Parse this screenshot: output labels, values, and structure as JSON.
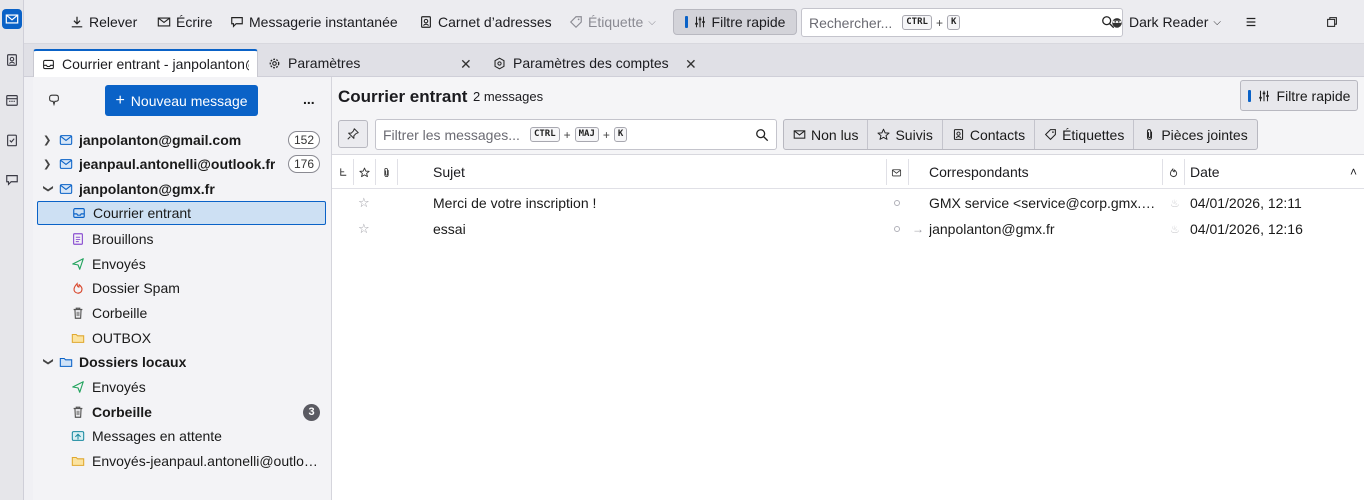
{
  "toolbar": {
    "get_messages": "Relever",
    "write": "Écrire",
    "chat": "Messagerie instantanée",
    "address_book": "Carnet d’adresses",
    "tag": "Étiquette",
    "quick_filter": "Filtre rapide",
    "search_placeholder": "Rechercher...",
    "search_key1": "CTRL",
    "search_plus": "+",
    "search_key2": "K",
    "dark_reader": "Dark Reader"
  },
  "tabs": [
    {
      "label": "Courrier entrant - janpolanton@gmx.fr"
    },
    {
      "label": "Paramètres"
    },
    {
      "label": "Paramètres des comptes"
    }
  ],
  "folder_pane": {
    "new_message": "Nouveau message",
    "more": "...",
    "accounts": [
      {
        "label": "janpolanton@gmail.com",
        "count": "152"
      },
      {
        "label": "jeanpaul.antonelli@outlook.fr",
        "count": "176"
      },
      {
        "label": "janpolanton@gmx.fr"
      }
    ],
    "gmx_folders": [
      {
        "label": "Courrier entrant"
      },
      {
        "label": "Brouillons"
      },
      {
        "label": "Envoyés"
      },
      {
        "label": "Dossier Spam"
      },
      {
        "label": "Corbeille"
      },
      {
        "label": "OUTBOX"
      }
    ],
    "local": {
      "label": "Dossiers locaux"
    },
    "local_folders": [
      {
        "label": "Envoyés"
      },
      {
        "label": "Corbeille",
        "count": "3"
      },
      {
        "label": "Messages en attente"
      },
      {
        "label": "Envoyés-jeanpaul.antonelli@outlook.fr"
      }
    ]
  },
  "message_pane": {
    "folder_title": "Courrier entrant",
    "message_count": "2 messages",
    "quick_filter": "Filtre rapide",
    "filter_placeholder": "Filtrer les messages...",
    "filter_key1": "CTRL",
    "filter_key2": "MAJ",
    "filter_key3": "K",
    "filter_plus": "+",
    "filters": [
      "Non lus",
      "Suivis",
      "Contacts",
      "Étiquettes",
      "Pièces jointes"
    ],
    "columns": {
      "subject": "Sujet",
      "correspondents": "Correspondants",
      "date": "Date"
    },
    "messages": [
      {
        "subject": "Merci de votre inscription !",
        "correspondent": "GMX service <service@corp.gmx.com>",
        "date": "04/01/2026, 12:11"
      },
      {
        "subject": "essai",
        "correspondent": "janpolanton@gmx.fr",
        "date": "04/01/2026, 12:16"
      }
    ]
  },
  "colors": {
    "accent": "#0a62c7",
    "selected_bg": "#cde0f3"
  }
}
